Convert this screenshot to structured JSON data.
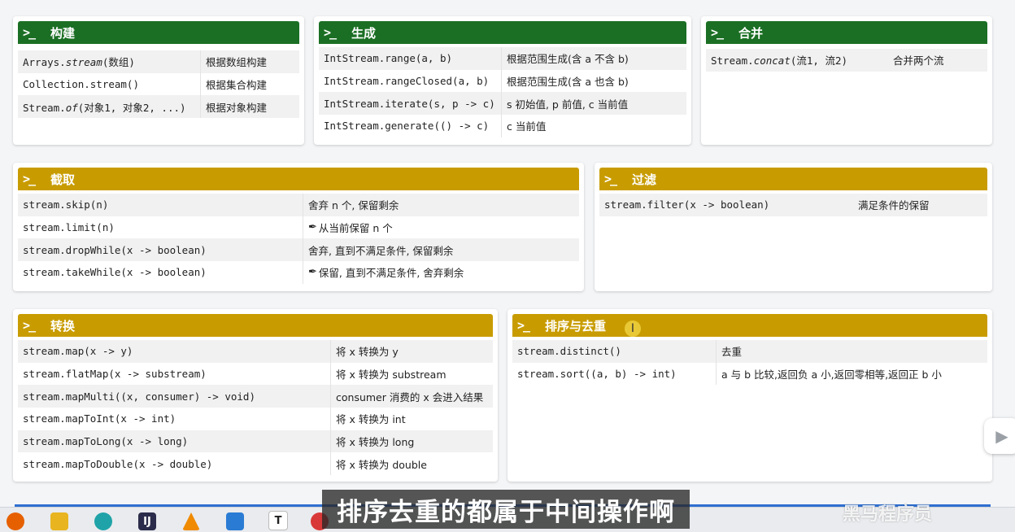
{
  "sections": {
    "build": {
      "title": "构建",
      "rows": [
        {
          "code_pre": "Arrays.",
          "code_it": "stream",
          "code_post": "(数组)",
          "desc": "根据数组构建"
        },
        {
          "code_pre": "Collection.stream()",
          "code_it": "",
          "code_post": "",
          "desc": "根据集合构建"
        },
        {
          "code_pre": "Stream.",
          "code_it": "of",
          "code_post": "(对象1, 对象2, ...)",
          "desc": "根据对象构建"
        }
      ]
    },
    "generate": {
      "title": "生成",
      "rows": [
        {
          "code": "IntStream.range(a, b)",
          "desc": "根据范围生成(含 a 不含 b)"
        },
        {
          "code": "IntStream.rangeClosed(a, b)",
          "desc": "根据范围生成(含 a 也含 b)"
        },
        {
          "code": "IntStream.iterate(s, p -> c)",
          "desc": "s 初始值, p 前值, c 当前值"
        },
        {
          "code": "IntStream.generate(() -> c)",
          "desc": "c 当前值"
        }
      ]
    },
    "merge": {
      "title": "合并",
      "rows": [
        {
          "code_pre": "Stream.",
          "code_it": "concat",
          "code_post": "(流1, 流2)",
          "desc": "合并两个流"
        }
      ]
    },
    "slice": {
      "title": "截取",
      "rows": [
        {
          "code": "stream.skip(n)",
          "desc": "舍弃 n 个, 保留剩余"
        },
        {
          "code": "stream.limit(n)",
          "desc": "从当前保留 n 个"
        },
        {
          "code": "stream.dropWhile(x -> boolean)",
          "desc": "舍弃, 直到不满足条件, 保留剩余"
        },
        {
          "code": "stream.takeWhile(x -> boolean)",
          "desc": "保留, 直到不满足条件, 舍弃剩余"
        }
      ]
    },
    "filter": {
      "title": "过滤",
      "rows": [
        {
          "code": "stream.filter(x -> boolean)",
          "desc": "满足条件的保留"
        }
      ]
    },
    "convert": {
      "title": "转换",
      "rows": [
        {
          "code": "stream.map(x -> y)",
          "desc": "将 x 转换为 y"
        },
        {
          "code": "stream.flatMap(x -> substream)",
          "desc": "将 x 转换为 substream"
        },
        {
          "code": "stream.mapMulti((x, consumer) -> void)",
          "desc": "consumer 消费的 x 会进入结果"
        },
        {
          "code": "stream.mapToInt(x -> int)",
          "desc": "将 x 转换为 int"
        },
        {
          "code": "stream.mapToLong(x -> long)",
          "desc": "将 x 转换为 long"
        },
        {
          "code": "stream.mapToDouble(x -> double)",
          "desc": "将 x 转换为 double"
        }
      ]
    },
    "sort": {
      "title": "排序与去重",
      "rows": [
        {
          "code": "stream.distinct()",
          "desc": "去重"
        },
        {
          "code": "stream.sort((a, b) -> int)",
          "desc": "a 与 b 比较,返回负 a 小,返回零相等,返回正 b 小"
        }
      ]
    }
  },
  "prompt_icon": ">_",
  "subtitle": "排序去重的都属于中间操作啊",
  "watermark": "黑马程序员",
  "colors": {
    "green": "#1b6f24",
    "gold": "#c89c00"
  }
}
